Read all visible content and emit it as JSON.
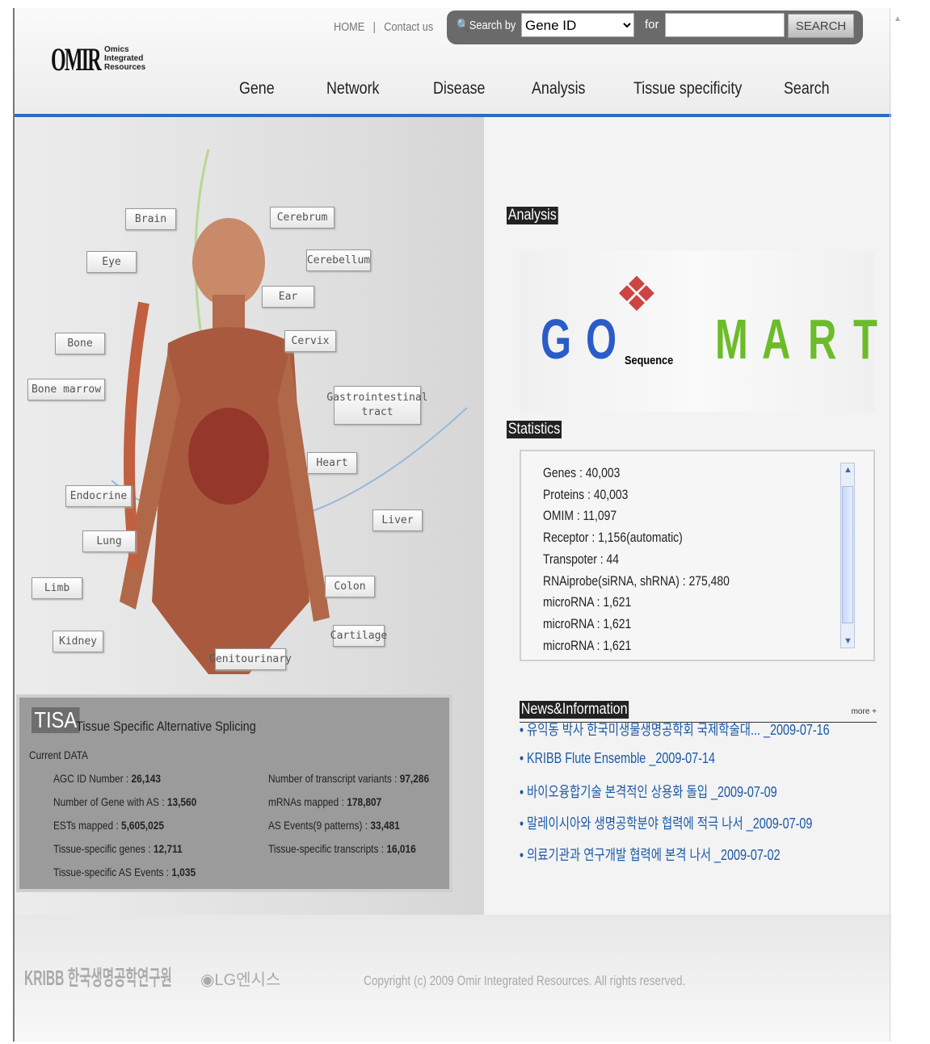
{
  "header": {
    "logo_text": "OMIR",
    "logo_sub": [
      "Omics",
      "Integrated",
      "Resources"
    ],
    "home": "HOME",
    "separator": "|",
    "contact": "Contact us",
    "search": {
      "label": "Search by",
      "select_value": "Gene ID",
      "for_label": "for",
      "input_value": "",
      "button": "SEARCH"
    },
    "nav": [
      "Gene",
      "Network",
      "Disease",
      "Analysis",
      "Tissue specificity",
      "Search"
    ]
  },
  "organs": [
    "Brain",
    "Cerebrum",
    "Eye",
    "Cerebellum",
    "Ear",
    "Bone",
    "Cervix",
    "Bone marrow",
    "Gastrointestinal tract",
    "Heart",
    "Endocrine",
    "Liver",
    "Lung",
    "Limb",
    "Colon",
    "Kidney",
    "Cartilage",
    "Genitourinary"
  ],
  "tisa": {
    "logo": "TISA",
    "title": "Tissue Specific Alternative Splicing",
    "current": "Current DATA",
    "left": [
      {
        "label": "AGC ID Number : ",
        "value": "26,143"
      },
      {
        "label": "Number of Gene with AS : ",
        "value": "13,560"
      },
      {
        "label": "ESTs mapped : ",
        "value": "5,605,025"
      },
      {
        "label": "Tissue-specific genes : ",
        "value": "12,711"
      },
      {
        "label": "Tissue-specific AS Events : ",
        "value": "1,035"
      }
    ],
    "right": [
      {
        "label": "Number of transcript variants : ",
        "value": "97,286"
      },
      {
        "label": "mRNAs mapped : ",
        "value": "178,807"
      },
      {
        "label": "AS Events(9 patterns) : ",
        "value": "33,481"
      },
      {
        "label": "Tissue-specific transcripts : ",
        "value": "16,016"
      }
    ]
  },
  "analysis": {
    "title": "Analysis",
    "letters": [
      "G",
      "O",
      "M",
      "A",
      "R",
      "T"
    ],
    "sequence": "Sequence"
  },
  "statistics": {
    "title": "Statistics",
    "items": [
      "Genes : 40,003",
      "Proteins : 40,003",
      "OMIM : 11,097",
      "Receptor : 1,156(automatic)",
      "Transpoter : 44",
      "RNAiprobe(siRNA, shRNA) : 275,480",
      "microRNA : 1,621",
      "microRNA : 1,621",
      "microRNA : 1,621"
    ]
  },
  "news": {
    "title": "News&Information",
    "more": "more +",
    "items": [
      "유익동 박사 한국미생물생명공학회 국제학술대... _2009-07-16",
      "KRIBB Flute Ensemble _2009-07-14",
      "바이오융합기술 본격적인 상용화 돌입 _2009-07-09",
      "말레이시아와 생명공학분야 협력에 적극 나서 _2009-07-09",
      "의료기관과 연구개발 협력에 본격 나서 _2009-07-02"
    ]
  },
  "footer": {
    "kribb": "KRIBB 한국생명공학연구원",
    "lg": "LG엔시스",
    "copyright": "Copyright (c) 2009 Omir Integrated Resources. All rights reserved."
  }
}
